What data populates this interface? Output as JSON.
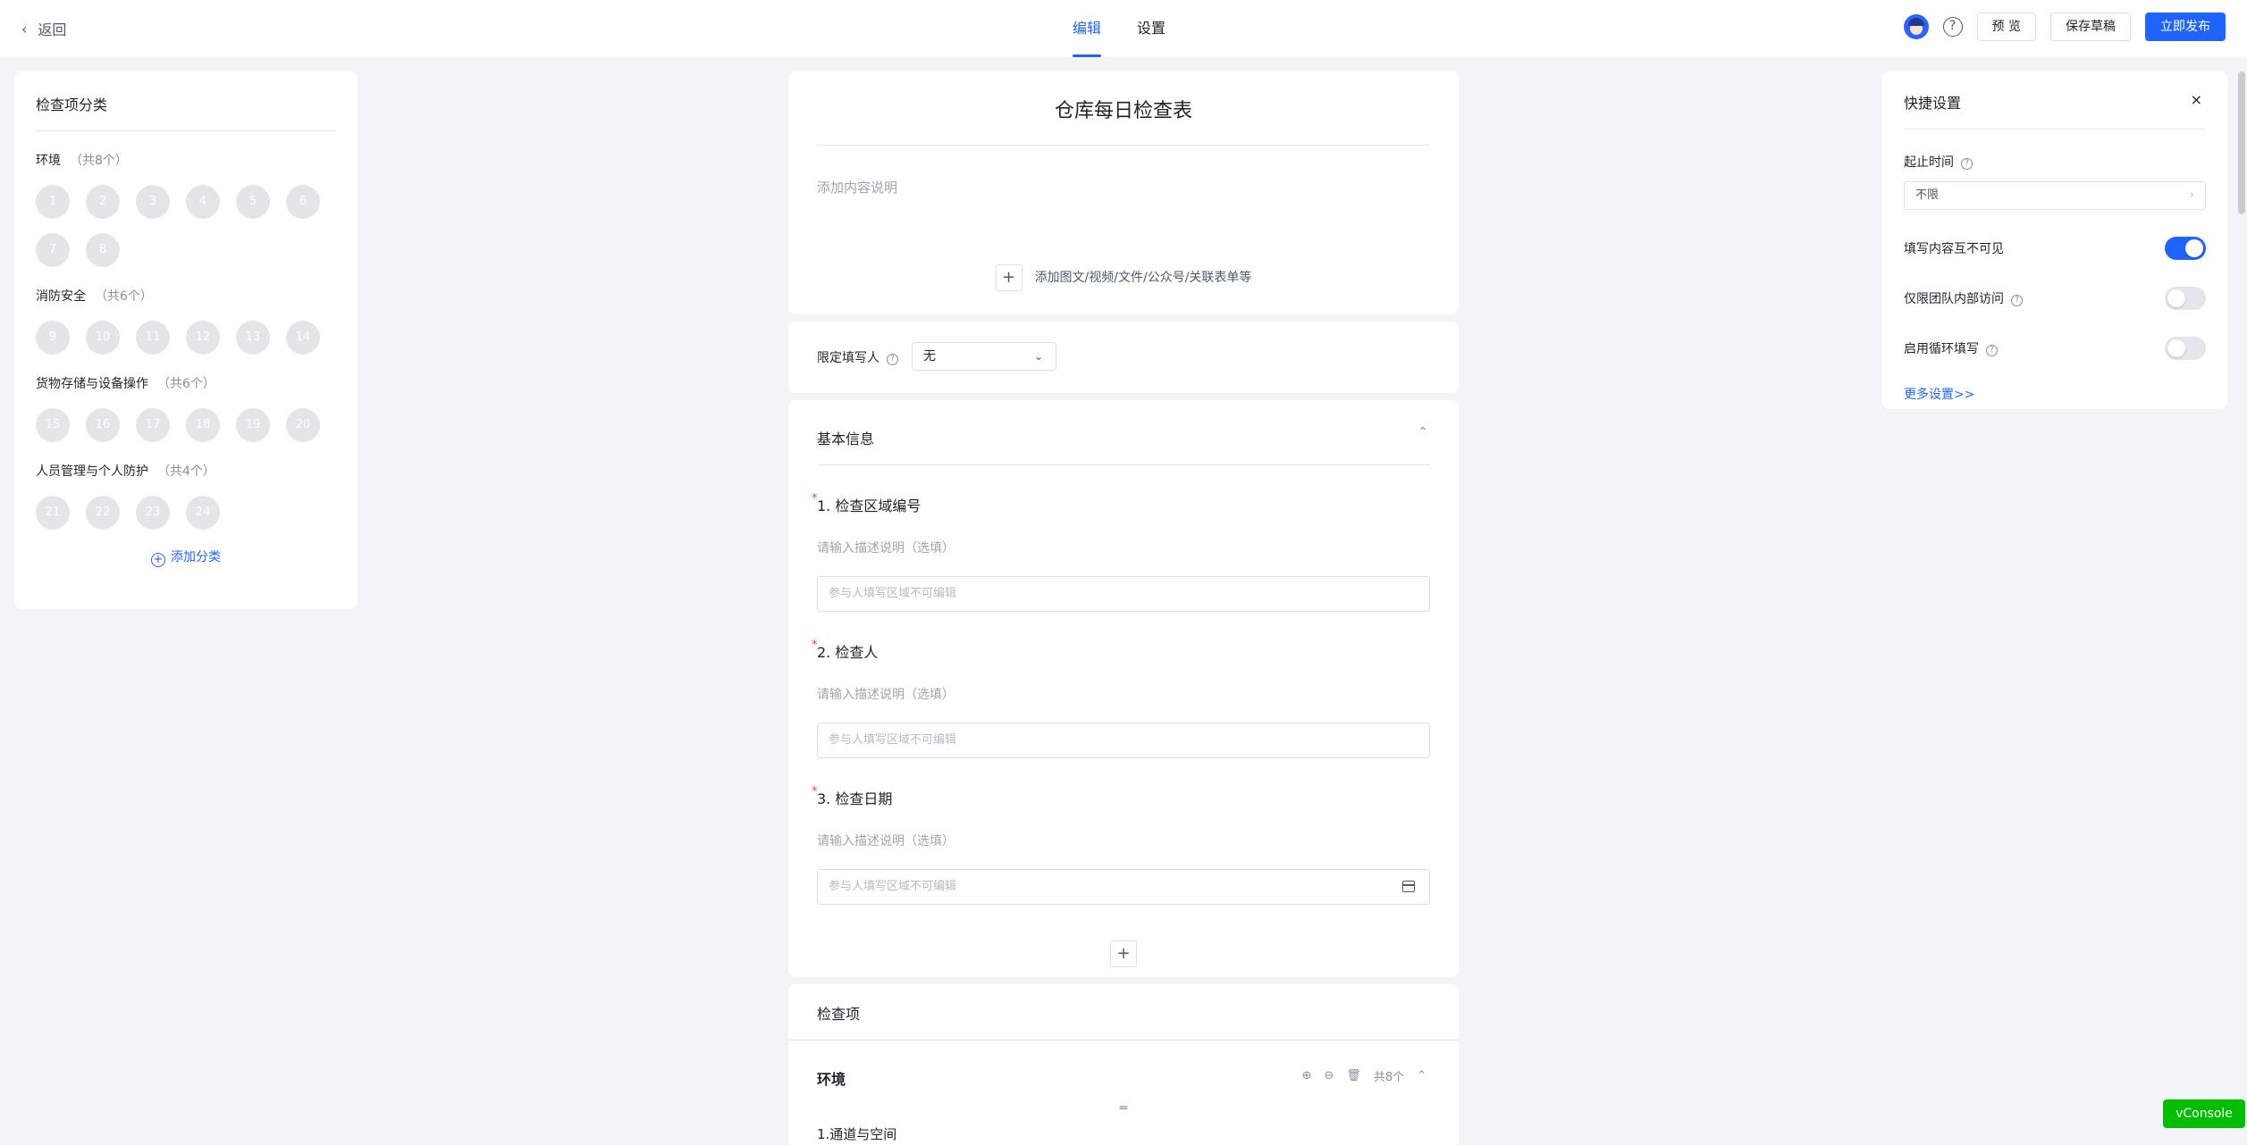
{
  "header": {
    "back_label": "返回",
    "tabs": [
      {
        "label": "编辑"
      },
      {
        "label": "设置"
      }
    ],
    "preview_label": "预 览",
    "save_draft_label": "保存草稿",
    "publish_label": "立即发布",
    "help_symbol": "?",
    "accent_color": "#1f64ff"
  },
  "left_panel": {
    "title": "检查项分类",
    "categories": [
      {
        "name": "环境",
        "count": "（共8个）",
        "items": [
          "1",
          "2",
          "3",
          "4",
          "5",
          "6",
          "7",
          "8"
        ]
      },
      {
        "name": "消防安全",
        "count": "（共6个）",
        "items": [
          "9",
          "10",
          "11",
          "12",
          "13",
          "14"
        ]
      },
      {
        "name": "货物存储与设备操作",
        "count": "（共6个）",
        "items": [
          "15",
          "16",
          "17",
          "18",
          "19",
          "20"
        ]
      },
      {
        "name": "人员管理与个人防护",
        "count": "（共4个）",
        "items": [
          "21",
          "22",
          "23",
          "24"
        ]
      }
    ],
    "add_category_label": "添加分类"
  },
  "form": {
    "title": "仓库每日检查表",
    "description_placeholder": "添加内容说明",
    "add_media_label": "添加图文/视频/文件/公众号/关联表单等",
    "restrict_label": "限定填写人",
    "restrict_value": "无",
    "basic_section_title": "基本信息",
    "questions": [
      {
        "title": "1. 检查区域编号",
        "desc": "请输入描述说明（选填）",
        "placeholder": "参与人填写区域不可编辑"
      },
      {
        "title": "2. 检查人",
        "desc": "请输入描述说明（选填）",
        "placeholder": "参与人填写区域不可编辑"
      },
      {
        "title": "3. 检查日期",
        "desc": "请输入描述说明（选填）",
        "placeholder": "参与人填写区域不可编辑"
      }
    ],
    "check_section_title": "检查项",
    "env_group": {
      "title": "环境",
      "count": "共8个",
      "first_item": "1.通道与空间"
    }
  },
  "quick_settings": {
    "title": "快捷设置",
    "time_label": "起止时间",
    "time_value": "不限",
    "toggles": [
      {
        "label": "填写内容互不可见",
        "on": true
      },
      {
        "label": "仅限团队内部访问",
        "on": false
      },
      {
        "label": "启用循环填写",
        "on": false
      }
    ],
    "more_label": "更多设置>>"
  },
  "vconsole_label": "vConsole"
}
